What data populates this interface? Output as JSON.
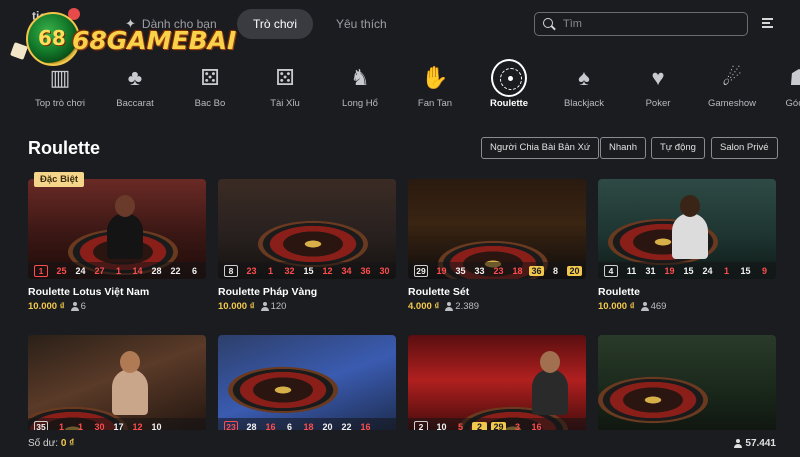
{
  "logo": {
    "text": "68GAMEBAI",
    "underlay": "tion"
  },
  "nav": {
    "for_you": "Dành cho bạn",
    "games": "Trò chơi",
    "favorites": "Yêu thích"
  },
  "search": {
    "placeholder": "Tìm"
  },
  "categories": [
    {
      "label": "Top trò chơi",
      "icon": "top-games-icon"
    },
    {
      "label": "Baccarat",
      "icon": "baccarat-icon"
    },
    {
      "label": "Bac Bo",
      "icon": "dice-icon"
    },
    {
      "label": "Tài Xỉu",
      "icon": "dice-icon"
    },
    {
      "label": "Long Hổ",
      "icon": "dragon-icon"
    },
    {
      "label": "Fan Tan",
      "icon": "fan-tan-icon"
    },
    {
      "label": "Roulette",
      "icon": "roulette-icon",
      "active": true
    },
    {
      "label": "Blackjack",
      "icon": "cards-icon"
    },
    {
      "label": "Poker",
      "icon": "poker-icon"
    },
    {
      "label": "Gameshow",
      "icon": "microphone-icon"
    },
    {
      "label": "Góc N",
      "icon": "corner-icon"
    }
  ],
  "section": {
    "title": "Roulette",
    "filters": [
      "Người Chia Bài Bản Xứ",
      "Nhanh",
      "Tự động",
      "Salon Privé"
    ]
  },
  "games": [
    {
      "title": "Roulette Lotus Việt Nam",
      "bet": "10.000 ₫",
      "players": "6",
      "badge": "Đặc Biệt",
      "results": [
        {
          "v": "1",
          "c": "red",
          "boxed": true
        },
        {
          "v": "25",
          "c": "red"
        },
        {
          "v": "24",
          "c": "white"
        },
        {
          "v": "27",
          "c": "red"
        },
        {
          "v": "1",
          "c": "red"
        },
        {
          "v": "14",
          "c": "red"
        },
        {
          "v": "28",
          "c": "white"
        },
        {
          "v": "22",
          "c": "white"
        },
        {
          "v": "6",
          "c": "white"
        }
      ]
    },
    {
      "title": "Roulette Pháp Vàng",
      "bet": "10.000 ₫",
      "players": "120",
      "results": [
        {
          "v": "8",
          "c": "white",
          "boxed": true
        },
        {
          "v": "23",
          "c": "red"
        },
        {
          "v": "1",
          "c": "red"
        },
        {
          "v": "32",
          "c": "red"
        },
        {
          "v": "15",
          "c": "white"
        },
        {
          "v": "12",
          "c": "red"
        },
        {
          "v": "34",
          "c": "red"
        },
        {
          "v": "36",
          "c": "red"
        },
        {
          "v": "30",
          "c": "red"
        }
      ]
    },
    {
      "title": "Roulette Sét",
      "bet": "4.000 ₫",
      "players": "2.389",
      "results": [
        {
          "v": "29",
          "c": "white",
          "boxed": true
        },
        {
          "v": "19",
          "c": "red"
        },
        {
          "v": "35",
          "c": "white"
        },
        {
          "v": "33",
          "c": "white"
        },
        {
          "v": "23",
          "c": "red"
        },
        {
          "v": "18",
          "c": "red"
        },
        {
          "v": "36",
          "c": "mult"
        },
        {
          "v": "8",
          "c": "white"
        },
        {
          "v": "20",
          "c": "mult"
        }
      ]
    },
    {
      "title": "Roulette",
      "bet": "10.000 ₫",
      "players": "469",
      "results": [
        {
          "v": "4",
          "c": "white",
          "boxed": true
        },
        {
          "v": "11",
          "c": "white"
        },
        {
          "v": "31",
          "c": "white"
        },
        {
          "v": "19",
          "c": "red"
        },
        {
          "v": "15",
          "c": "white"
        },
        {
          "v": "24",
          "c": "white"
        },
        {
          "v": "1",
          "c": "red"
        },
        {
          "v": "15",
          "c": "white"
        },
        {
          "v": "9",
          "c": "red"
        }
      ]
    },
    {
      "title": "",
      "bet": "",
      "players": "",
      "results": [
        {
          "v": "35",
          "c": "white",
          "boxed": true
        },
        {
          "v": "1",
          "c": "red"
        },
        {
          "v": "1",
          "c": "red"
        },
        {
          "v": "30",
          "c": "red"
        },
        {
          "v": "17",
          "c": "white"
        },
        {
          "v": "12",
          "c": "red"
        },
        {
          "v": "10",
          "c": "white"
        }
      ]
    },
    {
      "title": "",
      "bet": "",
      "players": "",
      "results": [
        {
          "v": "23",
          "c": "red",
          "boxed": true
        },
        {
          "v": "28",
          "c": "white"
        },
        {
          "v": "16",
          "c": "red"
        },
        {
          "v": "6",
          "c": "white"
        },
        {
          "v": "18",
          "c": "red"
        },
        {
          "v": "20",
          "c": "white"
        },
        {
          "v": "22",
          "c": "white"
        },
        {
          "v": "16",
          "c": "red"
        }
      ]
    },
    {
      "title": "",
      "bet": "",
      "players": "",
      "results": [
        {
          "v": "2",
          "c": "white",
          "boxed": true
        },
        {
          "v": "10",
          "c": "white"
        },
        {
          "v": "5",
          "c": "red"
        },
        {
          "v": "2",
          "c": "mult"
        },
        {
          "v": "29",
          "c": "mult"
        },
        {
          "v": "3",
          "c": "red"
        },
        {
          "v": "16",
          "c": "red"
        }
      ]
    },
    {
      "title": "",
      "bet": "",
      "players": "",
      "results": []
    }
  ],
  "bottom": {
    "balance_label": "Số dư:",
    "balance_value": "0 ₫",
    "online": "57.441"
  },
  "colors": {
    "accent": "#f2c94c",
    "red": "#ff4d4d",
    "background": "#1b1c20"
  }
}
